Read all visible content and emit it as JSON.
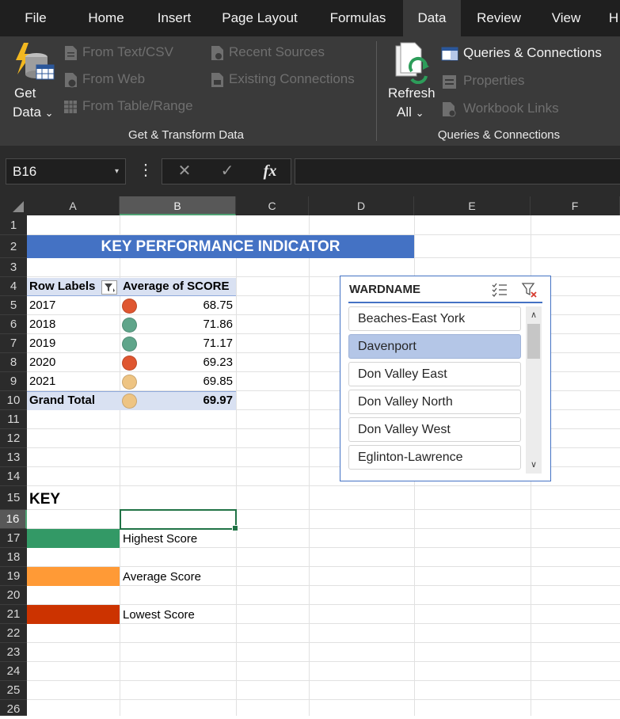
{
  "menu": {
    "tabs": [
      "File",
      "Home",
      "Insert",
      "Page Layout",
      "Formulas",
      "Data",
      "Review",
      "View",
      "H"
    ],
    "active": "Data"
  },
  "ribbon": {
    "get_data": {
      "line1": "Get",
      "line2": "Data",
      "chevron": "⌄"
    },
    "from_text_csv": "From Text/CSV",
    "from_web": "From Web",
    "from_table_range": "From Table/Range",
    "recent_sources": "Recent Sources",
    "existing_connections": "Existing Connections",
    "get_transform_label": "Get & Transform Data",
    "refresh_all": {
      "line1": "Refresh",
      "line2": "All",
      "chevron": "⌄"
    },
    "queries_connections": "Queries & Connections",
    "properties": "Properties",
    "workbook_links": "Workbook Links",
    "queries_group_label": "Queries & Connections"
  },
  "formula_bar": {
    "name_box": "B16",
    "dropdown_arrow": "▾",
    "more": "⋮",
    "cancel": "✕",
    "enter": "✓",
    "fx": "fx",
    "value": ""
  },
  "columns": [
    "A",
    "B",
    "C",
    "D",
    "E",
    "F"
  ],
  "rows": [
    "1",
    "2",
    "3",
    "4",
    "5",
    "6",
    "7",
    "8",
    "9",
    "10",
    "11",
    "12",
    "13",
    "14",
    "15",
    "16",
    "17",
    "18",
    "19",
    "20",
    "21",
    "22",
    "23",
    "24",
    "25",
    "26"
  ],
  "active_cell": "B16",
  "kpi_title": "KEY PERFORMANCE INDICATOR",
  "pivot": {
    "header_row_labels": "Row Labels",
    "header_value": "Average of SCORE",
    "rows": [
      {
        "label": "2017",
        "value": "68.75",
        "status": "low"
      },
      {
        "label": "2018",
        "value": "71.86",
        "status": "high"
      },
      {
        "label": "2019",
        "value": "71.17",
        "status": "high"
      },
      {
        "label": "2020",
        "value": "69.23",
        "status": "low"
      },
      {
        "label": "2021",
        "value": "69.85",
        "status": "average"
      }
    ],
    "total": {
      "label": "Grand Total",
      "value": "69.97",
      "status": "average"
    }
  },
  "indicator_colors": {
    "high": "#5fa58a",
    "average": "#eec483",
    "low": "#df5630"
  },
  "key": {
    "title": "KEY",
    "items": [
      {
        "label": "Highest Score",
        "color": "#339966"
      },
      {
        "label": "Average Score",
        "color": "#ff9a36"
      },
      {
        "label": "Lowest Score",
        "color": "#cc3300"
      }
    ]
  },
  "slicer": {
    "title": "WARDNAME",
    "items": [
      "Beaches-East York",
      "Davenport",
      "Don Valley East",
      "Don Valley North",
      "Don Valley West",
      "Eglinton-Lawrence"
    ],
    "selected": "Davenport",
    "scroll_up": "∧",
    "scroll_down": "∨"
  }
}
